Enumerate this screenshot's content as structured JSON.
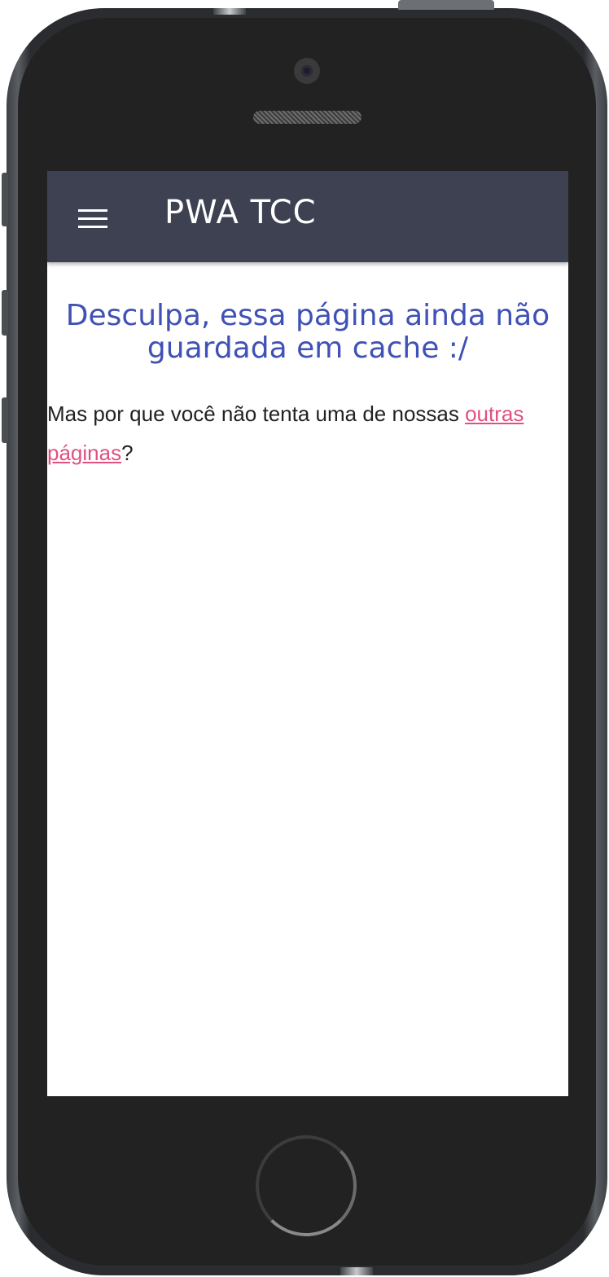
{
  "app_bar": {
    "title": "PWA TCC",
    "menu_icon": "hamburger-menu-icon"
  },
  "content": {
    "heading": "Desculpa, essa página ainda não guardada em cache :/",
    "message_prefix": "Mas por que você não tenta uma de nossas ",
    "link_text": "outras páginas",
    "message_suffix": "?"
  },
  "colors": {
    "app_bar": "#3e4152",
    "heading": "#3f51b5",
    "link": "#e0517f"
  }
}
